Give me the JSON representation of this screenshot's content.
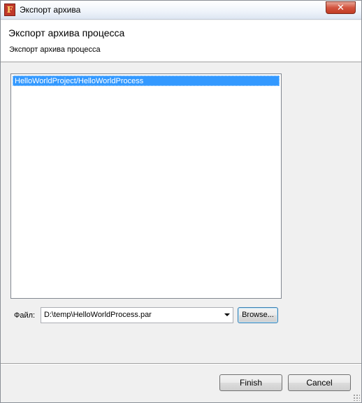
{
  "window": {
    "title": "Экспорт архива",
    "close_glyph": "✕",
    "app_icon_glyph": "F"
  },
  "header": {
    "title": "Экспорт архива процесса",
    "description": "Экспорт архива процесса"
  },
  "process_list": {
    "items": [
      {
        "label": "HelloWorldProject/HelloWorldProcess",
        "selected": true
      }
    ]
  },
  "file": {
    "label": "Файл:",
    "value": "D:\\temp\\HelloWorldProcess.par",
    "browse_label": "Browse..."
  },
  "buttons": {
    "finish_label": "Finish",
    "cancel_label": "Cancel"
  },
  "colors": {
    "selection": "#3399ff",
    "close": "#c23b22",
    "dialog_bg": "#f0f0f0"
  }
}
